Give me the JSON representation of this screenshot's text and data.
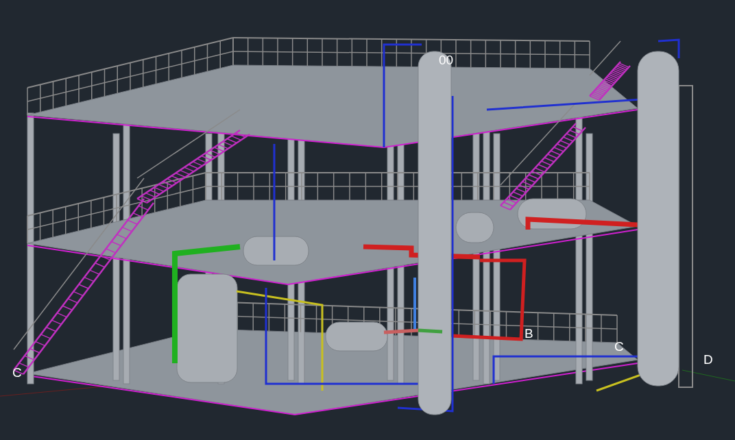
{
  "viewport": {
    "grid_labels": [
      {
        "text": "00"
      },
      {
        "text": "B"
      },
      {
        "text": "C"
      },
      {
        "text": "D"
      },
      {
        "text": "C"
      }
    ]
  }
}
